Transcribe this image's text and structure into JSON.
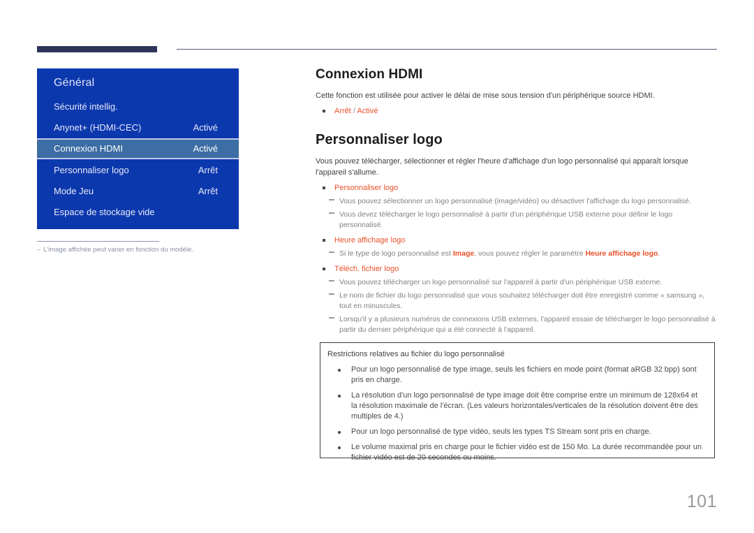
{
  "header": {
    "rule_accent_color": "#2e3459",
    "rule_line_color": "#545a77"
  },
  "osd_menu": {
    "title": "Général",
    "background_color": "#0c38ae",
    "selected_row_color": "#3c6da4",
    "rows": [
      {
        "label": "Sécurité intellig.",
        "value": "",
        "selected": false
      },
      {
        "label": "Anynet+ (HDMI-CEC)",
        "value": "Activé",
        "selected": false
      },
      {
        "label": "Connexion HDMI",
        "value": "Activé",
        "selected": true
      },
      {
        "label": "Personnaliser logo",
        "value": "Arrêt",
        "selected": false
      },
      {
        "label": "Mode Jeu",
        "value": "Arrêt",
        "selected": false
      },
      {
        "label": "Espace de stockage vide",
        "value": "",
        "selected": false
      }
    ],
    "note": "L'image affichée peut varier en fonction du modèle."
  },
  "content": {
    "section1": {
      "title": "Connexion HDMI",
      "paragraph": "Cette fonction est utilisée pour activer le délai de mise sous tension d'un périphérique source HDMI.",
      "option_a": "Arrêt",
      "option_sep": " / ",
      "option_b": "Activé"
    },
    "section2": {
      "title": "Personnaliser logo",
      "paragraph": "Vous pouvez télécharger, sélectionner et régler l'heure d'affichage d'un logo personnalisé qui apparaît lorsque l'appareil s'allume.",
      "groups": [
        {
          "bullet": "Personnaliser logo",
          "dashes": [
            "Vous pouvez sélectionner un logo personnalisé (image/vidéo) ou désactiver l'affichage du logo personnalisé.",
            "Vous devez télécharger le logo personnalisé à partir d'un périphérique USB externe pour définir le logo personnalisé."
          ]
        },
        {
          "bullet": "Heure affichage logo",
          "dashes_rich": {
            "part1": "Si le type de logo personnalisé est ",
            "hl1": "Image",
            "part2": ", vous pouvez régler le paramètre ",
            "hl2": "Heure affichage logo",
            "part3": "."
          }
        },
        {
          "bullet": "Téléch. fichier logo",
          "dashes": [
            "Vous pouvez télécharger un logo personnalisé sur l'appareil à partir d'un périphérique USB externe.",
            "Le nom de fichier du logo personnalisé que vous souhaitez télécharger doit être enregistré comme « samsung », tout en minuscules.",
            "Lorsqu'il y a plusieurs numéros de connexions USB externes, l'appareil essaie de télécharger le logo personnalisé à partir du dernier périphérique qui a été connecté à l'appareil."
          ]
        }
      ]
    },
    "restriction_box": {
      "heading": "Restrictions relatives au fichier du logo personnalisé",
      "items": [
        "Pour un logo personnalisé de type image, seuls les fichiers en mode point (format aRGB 32 bpp) sont pris en charge.",
        "La résolution d'un logo personnalisé de type image doit être comprise entre un minimum de 128x64 et la résolution maximale de l'écran. (Les valeurs horizontales/verticales de la résolution doivent être des multiples de 4.)",
        "Pour un logo personnalisé de type vidéo, seuls les types TS Stream sont pris en charge.",
        "Le volume maximal pris en charge pour le fichier vidéo est de 150 Mo. La durée recommandée pour un fichier vidéo est de 20 secondes ou moins."
      ]
    }
  },
  "footer": {
    "page_number": "101"
  },
  "colors": {
    "accent_orange": "#e8502a",
    "menu_blue": "#0c38ae",
    "header_navy": "#2e3459"
  }
}
